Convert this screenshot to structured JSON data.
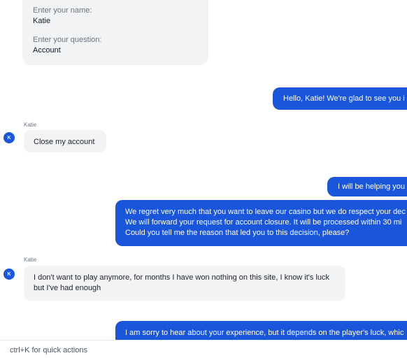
{
  "form": {
    "name_label": "Enter your name:",
    "name_value": "Katie",
    "question_label": "Enter your question:",
    "question_value": "Account"
  },
  "messages": [
    {
      "direction": "out",
      "text": "Hello, Katie! We're glad to see you i"
    },
    {
      "direction": "in",
      "sender": "Katie",
      "avatar": "K",
      "text": "Close my account"
    },
    {
      "direction": "out",
      "text": "I will be helping you"
    },
    {
      "direction": "out",
      "lines": [
        "We regret very much that you want to leave our casino but we do respect your dec",
        "We will forward your request for account closure. It will be processed within 30 mi",
        "Could you tell me the reason that led you to this decision, please?"
      ]
    },
    {
      "direction": "in",
      "sender": "Katie",
      "avatar": "K",
      "lines": [
        "I don't want to play anymore, for months I have won nothing on this site, I know it's luck",
        "but I've had enough"
      ]
    },
    {
      "direction": "out",
      "text": "I am sorry to hear about your experience, but it depends on the player's luck, whic"
    }
  ],
  "composer": {
    "placeholder": "ctrl+K for quick actions"
  },
  "colors": {
    "accent": "#1a56db",
    "incoming_bg": "#f2f3f5"
  }
}
